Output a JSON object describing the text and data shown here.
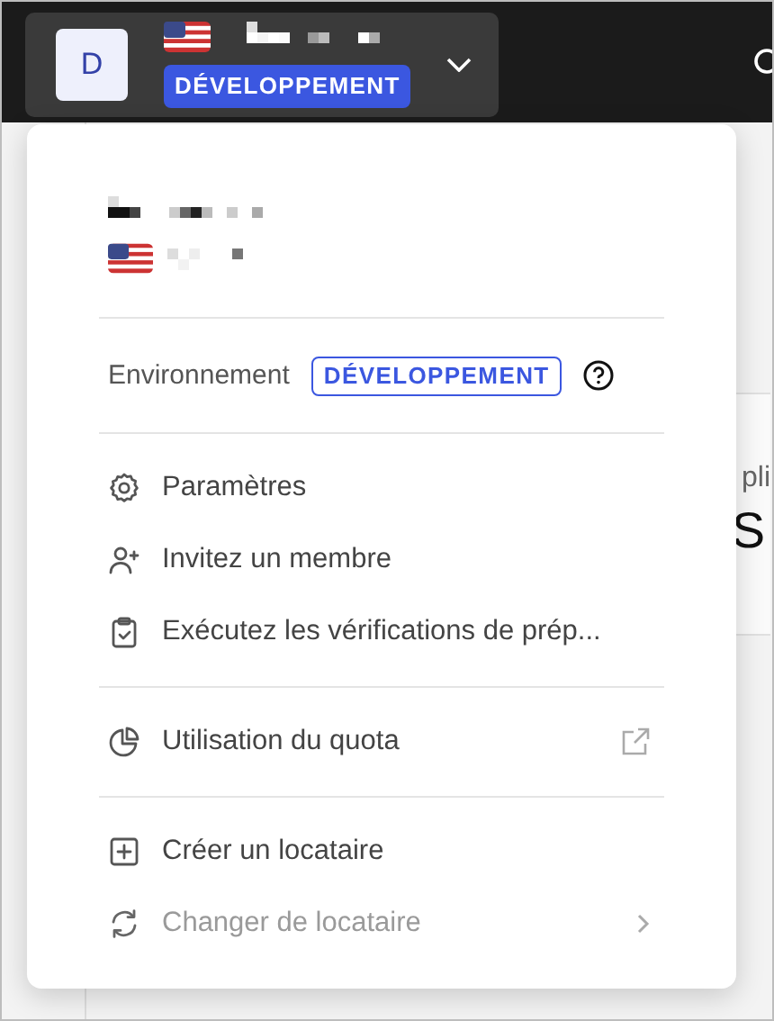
{
  "tenant_button": {
    "avatar": "D",
    "environment": "DÉVELOPPEMENT"
  },
  "background": {
    "card_title": "pli",
    "card_value": "S"
  },
  "menu": {
    "environment_label": "Environnement",
    "environment_badge": "DÉVELOPPEMENT",
    "sections": [
      [
        {
          "kind": "gear",
          "label": "Paramètres",
          "disabled": false
        },
        {
          "kind": "invite",
          "label": "Invitez un membre",
          "disabled": false
        },
        {
          "kind": "checklist",
          "label": "Exécutez les vérifications de prép...",
          "disabled": false
        }
      ],
      [
        {
          "kind": "quota",
          "label": "Utilisation du quota",
          "disabled": false,
          "external": true
        }
      ],
      [
        {
          "kind": "create",
          "label": "Créer un locataire",
          "disabled": false
        },
        {
          "kind": "switch",
          "label": "Changer de locataire",
          "disabled": true,
          "submenu": true
        }
      ]
    ]
  }
}
